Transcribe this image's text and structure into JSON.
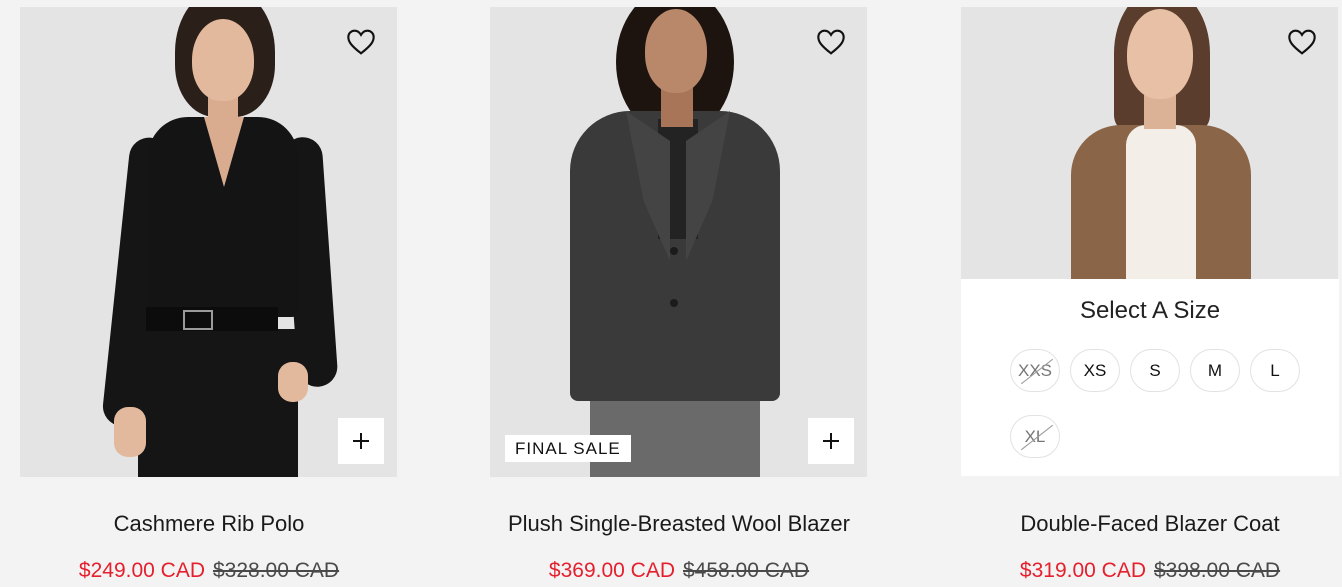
{
  "colors": {
    "sale": "#e5202e",
    "text": "#1a1a1a",
    "background": "#f3f3f3"
  },
  "products": [
    {
      "name": "Cashmere Rib Polo",
      "sale_price": "$249.00 CAD",
      "original_price": "$328.00 CAD",
      "wishlist_icon": "heart-outline-icon",
      "quick_add_icon": "plus-icon"
    },
    {
      "name": "Plush Single-Breasted Wool Blazer",
      "sale_price": "$369.00 CAD",
      "original_price": "$458.00 CAD",
      "badge": "FINAL SALE",
      "wishlist_icon": "heart-outline-icon",
      "quick_add_icon": "plus-icon"
    },
    {
      "name": "Double-Faced Blazer Coat",
      "sale_price": "$319.00 CAD",
      "original_price": "$398.00 CAD",
      "wishlist_icon": "heart-outline-icon",
      "size_selector": {
        "title": "Select A Size",
        "sizes": [
          {
            "label": "XXS",
            "available": false
          },
          {
            "label": "XS",
            "available": true
          },
          {
            "label": "S",
            "available": true
          },
          {
            "label": "M",
            "available": true
          },
          {
            "label": "L",
            "available": true
          },
          {
            "label": "XL",
            "available": false
          }
        ]
      }
    }
  ]
}
